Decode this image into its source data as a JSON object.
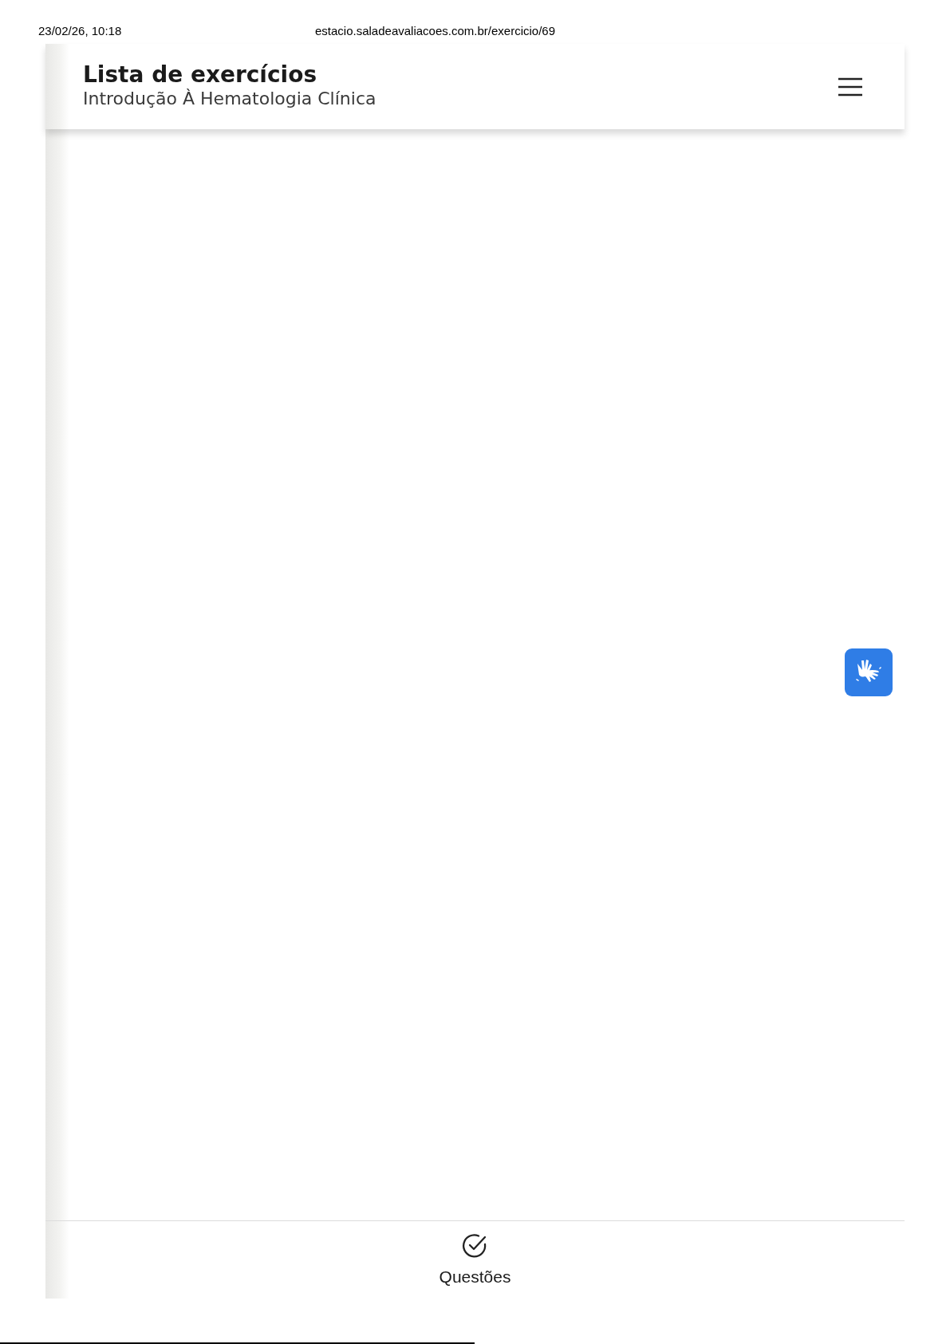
{
  "print_header": {
    "date_time": "23/02/26, 10:18",
    "url": "estacio.saladeavaliacoes.com.br/exercicio/69"
  },
  "header": {
    "title": "Lista de exercícios",
    "subtitle": "Introdução À Hematologia Clínica"
  },
  "bottom_nav": [
    {
      "label": "Questões"
    }
  ]
}
